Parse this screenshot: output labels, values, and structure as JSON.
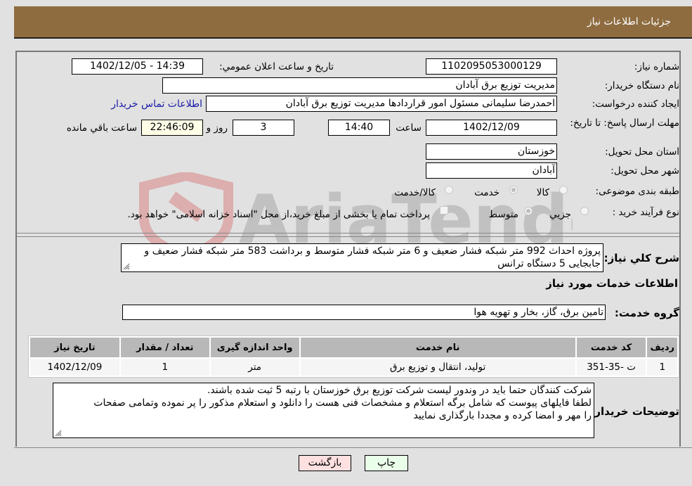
{
  "header": {
    "title": "جزئیات اطلاعات نیاز"
  },
  "form": {
    "need_number": {
      "label": "شماره نیاز:",
      "value": "1102095053000129"
    },
    "announce_datetime": {
      "label": "تاریخ و ساعت اعلان عمومي:",
      "value": "1402/12/05 - 14:39"
    },
    "buyer_org": {
      "label": "نام دستگاه خریدار:",
      "value": "مدیریت توزیع برق آبادان"
    },
    "requester": {
      "label": "ایجاد کننده درخواست:",
      "value": "احمدرضا سلیمانی مسئول امور قراردادها مدیریت توزیع برق آبادان"
    },
    "buyer_contact_link": "اطلاعات تماس خریدار",
    "deadline": {
      "label": "مهلت ارسال پاسخ: تا تاریخ:",
      "date": "1402/12/09",
      "time_label": "ساعت",
      "time": "14:40",
      "days": "3",
      "days_label": "روز و",
      "remaining": "22:46:09",
      "remaining_label": "ساعت باقي مانده"
    },
    "province": {
      "label": "استان محل تحویل:",
      "value": "خوزستان"
    },
    "city": {
      "label": "شهر محل تحویل:",
      "value": "آبادان"
    },
    "category": {
      "label": "طبقه بندی موضوعی:",
      "options": [
        "کالا",
        "خدمت",
        "کالا/خدمت"
      ],
      "selected": "خدمت"
    },
    "purchase_type": {
      "label": "نوع فرآیند خرید :",
      "options": [
        "جزيي",
        "متوسط"
      ],
      "selected": "متوسط",
      "payment_note": "پرداخت تمام یا بخشی از مبلغ خرید،از محل \"اسناد خزانه اسلامی\" خواهد بود."
    },
    "description": {
      "label": "شرح کلي نیاز:",
      "value": "پروژه احداث 992 متر شبکه فشار ضعیف و 6 متر شبکه فشار متوسط و برداشت 583 متر شبکه فشار ضعیف و جابجایی 5 دستگاه ترانس"
    }
  },
  "services": {
    "section_title": "اطلاعات خدمات مورد نیاز",
    "group_label": "گروه خدمت:",
    "group_value": "تامین برق، گاز، بخار و تهویه هوا",
    "table": {
      "headers": [
        "ردیف",
        "کد خدمت",
        "نام خدمت",
        "واحد اندازه گیری",
        "تعداد / مقدار",
        "تاریخ نیاز"
      ],
      "rows": [
        [
          "1",
          "ت -35-351",
          "تولید، انتقال و توزیع برق",
          "متر",
          "1",
          "1402/12/09"
        ]
      ]
    }
  },
  "buyer_notes": {
    "label": "توضیحات خریدار:",
    "lines": [
      "شرکت کنندگان حتما باید در وندور لیست شرکت توزیع برق خوزستان با رتبه 5 ثبت شده باشند.",
      "لطفا فایلهای پیوست که شامل برگه استعلام و مشخصات فنی هست را دانلود و استعلام مذکور را پر نموده وتمامی صفحات",
      "را مهر و امضا کرده و مجددا بارگذاری نمایید"
    ]
  },
  "buttons": {
    "print": "چاپ",
    "back": "بازگشت"
  },
  "watermark": {
    "text": "AriaTender.neT"
  },
  "colors": {
    "header_bg": "#8e6c40",
    "link": "#1a1aa8",
    "print_bg": "#eaffea",
    "back_bg": "#ffe0e0"
  }
}
